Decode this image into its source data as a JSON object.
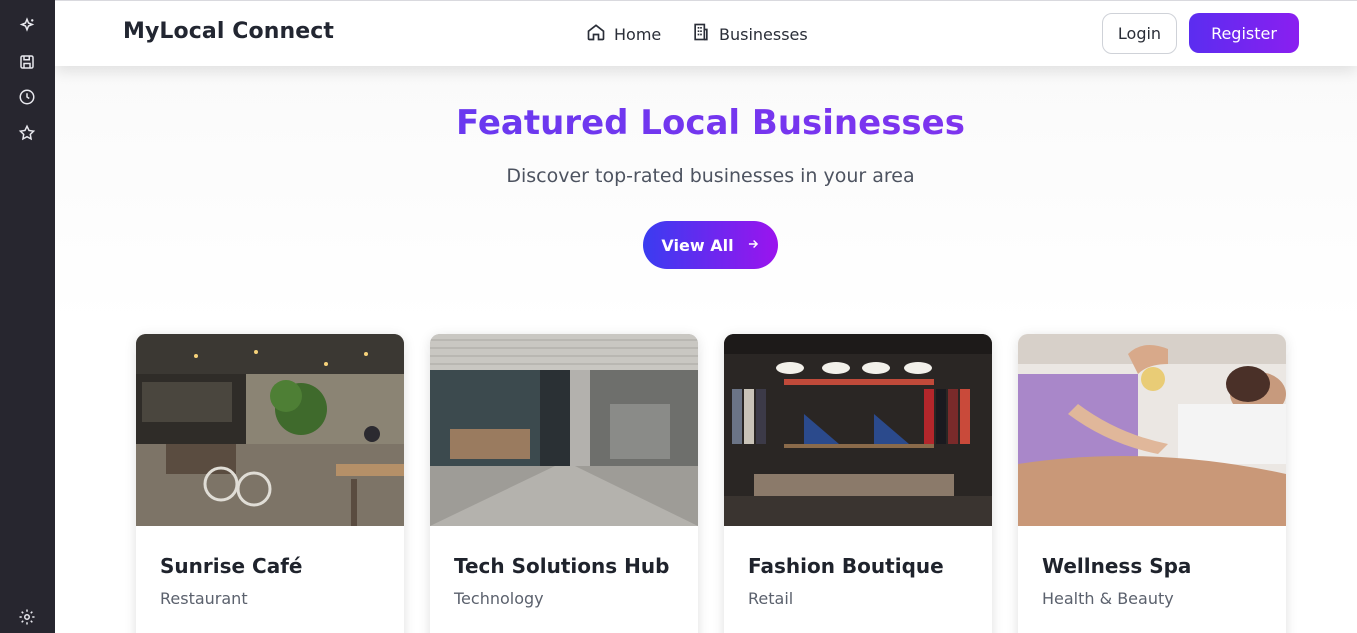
{
  "rail": {
    "icons": [
      "sparkle-icon",
      "save-icon",
      "history-icon",
      "star-icon",
      "settings-icon"
    ]
  },
  "header": {
    "brand": "MyLocal Connect",
    "nav": [
      {
        "label": "Home",
        "icon": "home-icon"
      },
      {
        "label": "Businesses",
        "icon": "building-icon"
      }
    ],
    "login_label": "Login",
    "register_label": "Register"
  },
  "hero": {
    "title": "Featured Local Businesses",
    "subtitle": "Discover top-rated businesses in your area",
    "cta_label": "View All",
    "cta_icon": "arrow-right-icon"
  },
  "cards": [
    {
      "name": "Sunrise Café",
      "category": "Restaurant",
      "image": "cafe-photo"
    },
    {
      "name": "Tech Solutions Hub",
      "category": "Technology",
      "image": "office-photo"
    },
    {
      "name": "Fashion Boutique",
      "category": "Retail",
      "image": "boutique-photo"
    },
    {
      "name": "Wellness Spa",
      "category": "Health & Beauty",
      "image": "spa-photo"
    }
  ],
  "colors": {
    "accent_start": "#5b2df0",
    "accent_end": "#8a1ff0",
    "rail_bg": "#27262f"
  }
}
